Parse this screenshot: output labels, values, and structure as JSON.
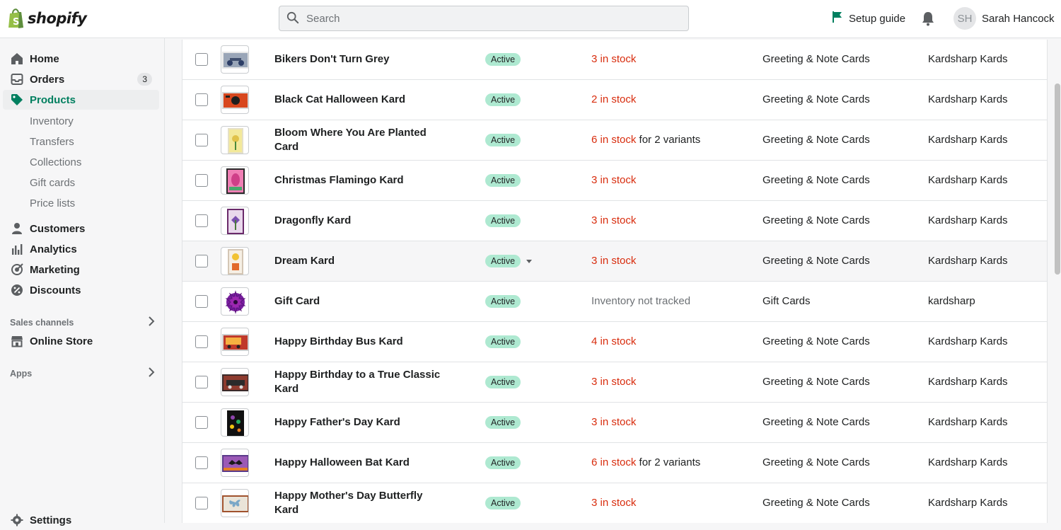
{
  "brand": {
    "name": "shopify",
    "color": "#95bf47"
  },
  "header": {
    "search_placeholder": "Search",
    "setup_guide": "Setup guide",
    "user_initials": "SH",
    "user_name": "Sarah Hancock"
  },
  "sidebar": {
    "home": "Home",
    "orders": "Orders",
    "orders_badge": "3",
    "products": "Products",
    "inventory": "Inventory",
    "transfers": "Transfers",
    "collections": "Collections",
    "gift_cards": "Gift cards",
    "price_lists": "Price lists",
    "customers": "Customers",
    "analytics": "Analytics",
    "marketing": "Marketing",
    "discounts": "Discounts",
    "sales_channels": "Sales channels",
    "online_store": "Online Store",
    "apps": "Apps",
    "settings": "Settings"
  },
  "products": [
    {
      "name": "Bikers Don't Turn Grey",
      "status": "Active",
      "stock": "3 in stock",
      "variants": "",
      "type": "Greeting & Note Cards",
      "vendor": "Kardsharp Kards"
    },
    {
      "name": "Black Cat Halloween Kard",
      "status": "Active",
      "stock": "2 in stock",
      "variants": "",
      "type": "Greeting & Note Cards",
      "vendor": "Kardsharp Kards"
    },
    {
      "name": "Bloom Where You Are Planted Card",
      "status": "Active",
      "stock": "6 in stock",
      "variants": "for 2 variants",
      "type": "Greeting & Note Cards",
      "vendor": "Kardsharp Kards"
    },
    {
      "name": "Christmas Flamingo Kard",
      "status": "Active",
      "stock": "3 in stock",
      "variants": "",
      "type": "Greeting & Note Cards",
      "vendor": "Kardsharp Kards"
    },
    {
      "name": "Dragonfly Kard",
      "status": "Active",
      "stock": "3 in stock",
      "variants": "",
      "type": "Greeting & Note Cards",
      "vendor": "Kardsharp Kards"
    },
    {
      "name": "Dream Kard",
      "status": "Active",
      "stock": "3 in stock",
      "variants": "",
      "type": "Greeting & Note Cards",
      "vendor": "Kardsharp Kards"
    },
    {
      "name": "Gift Card",
      "status": "Active",
      "stock": "Inventory not tracked",
      "variants": "",
      "type": "Gift Cards",
      "vendor": "kardsharp"
    },
    {
      "name": "Happy Birthday Bus Kard",
      "status": "Active",
      "stock": "4 in stock",
      "variants": "",
      "type": "Greeting & Note Cards",
      "vendor": "Kardsharp Kards"
    },
    {
      "name": "Happy Birthday to a True Classic Kard",
      "status": "Active",
      "stock": "3 in stock",
      "variants": "",
      "type": "Greeting & Note Cards",
      "vendor": "Kardsharp Kards"
    },
    {
      "name": "Happy Father's Day Kard",
      "status": "Active",
      "stock": "3 in stock",
      "variants": "",
      "type": "Greeting & Note Cards",
      "vendor": "Kardsharp Kards"
    },
    {
      "name": "Happy Halloween Bat Kard",
      "status": "Active",
      "stock": "6 in stock",
      "variants": "for 2 variants",
      "type": "Greeting & Note Cards",
      "vendor": "Kardsharp Kards"
    },
    {
      "name": "Happy Mother's Day Butterfly Kard",
      "status": "Active",
      "stock": "3 in stock",
      "variants": "",
      "type": "Greeting & Note Cards",
      "vendor": "Kardsharp Kards"
    }
  ]
}
